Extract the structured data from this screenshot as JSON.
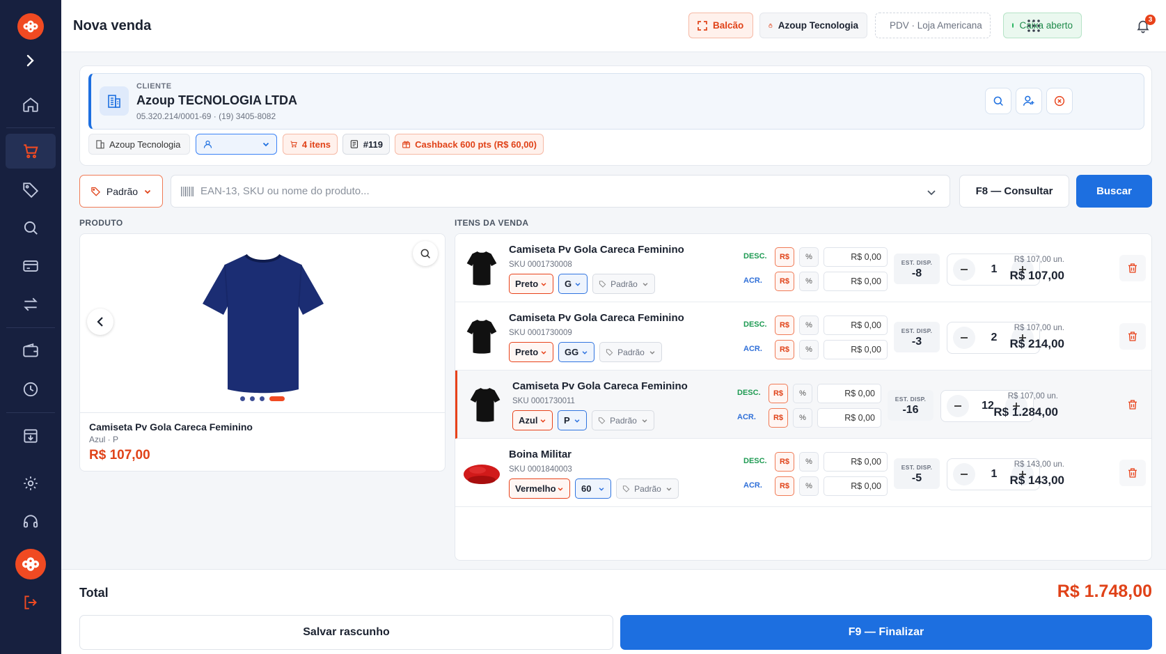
{
  "header": {
    "title": "Nova venda",
    "balcao": "Balcão",
    "empresa": "Azoup Tecnologia",
    "pdv": "PDV · Loja Americana",
    "caixa": "Caixa aberto",
    "notifications": "3"
  },
  "client": {
    "label": "CLIENTE",
    "name": "Azoup TECNOLOGIA LTDA",
    "doc": "05.320.214/0001-69 · (19) 3405-8082",
    "tags": {
      "empresa": "Azoup Tecnologia",
      "items": "4 itens",
      "number": "#119",
      "cashback": "Cashback 600 pts (R$ 60,00)"
    }
  },
  "search": {
    "price_table": "Padrão",
    "placeholder": "EAN-13, SKU ou nome do produto...",
    "consult": "F8 — Consultar",
    "search": "Buscar"
  },
  "sections": {
    "product": "PRODUTO",
    "items": "ITENS DA VENDA"
  },
  "product": {
    "name": "Camiseta Pv Gola Careca Feminino",
    "variant": "Azul · P",
    "price": "R$ 107,00"
  },
  "labels": {
    "desc": "DESC.",
    "acr": "ACR.",
    "rs": "R$",
    "pct": "%",
    "est": "EST. DISP."
  },
  "items": [
    {
      "name": "Camiseta Pv Gola Careca Feminino",
      "sku": "SKU 0001730008",
      "color": "Preto",
      "size": "G",
      "price_table": "Padrão",
      "desc": "R$ 0,00",
      "acr": "R$ 0,00",
      "stock": "-8",
      "qty": "1",
      "unit": "R$ 107,00 un.",
      "total": "R$ 107,00"
    },
    {
      "name": "Camiseta Pv Gola Careca Feminino",
      "sku": "SKU 0001730009",
      "color": "Preto",
      "size": "GG",
      "price_table": "Padrão",
      "desc": "R$ 0,00",
      "acr": "R$ 0,00",
      "stock": "-3",
      "qty": "2",
      "unit": "R$ 107,00 un.",
      "total": "R$ 214,00"
    },
    {
      "name": "Camiseta Pv Gola Careca Feminino",
      "sku": "SKU 0001730011",
      "color": "Azul",
      "size": "P",
      "price_table": "Padrão",
      "desc": "R$ 0,00",
      "acr": "R$ 0,00",
      "stock": "-16",
      "qty": "12",
      "unit": "R$ 107,00 un.",
      "total": "R$ 1.284,00"
    },
    {
      "name": "Boina Militar",
      "sku": "SKU 0001840003",
      "color": "Vermelho",
      "size": "60",
      "price_table": "Padrão",
      "desc": "R$ 0,00",
      "acr": "R$ 0,00",
      "stock": "-5",
      "qty": "1",
      "unit": "R$ 143,00 un.",
      "total": "R$ 143,00"
    }
  ],
  "footer": {
    "total_label": "Total",
    "total_value": "R$ 1.748,00",
    "draft": "Salvar rascunho",
    "finish": "F9 — Finalizar"
  },
  "colors": {
    "accent": "#e8421a",
    "primary": "#1d6fe0",
    "sidebar": "#17203f"
  }
}
